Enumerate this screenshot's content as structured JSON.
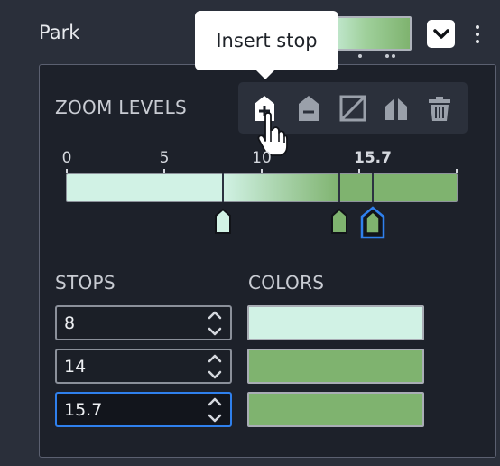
{
  "layer": {
    "title": "Park"
  },
  "tooltip": {
    "text": "Insert stop"
  },
  "zoom_levels": {
    "label": "ZOOM LEVELS",
    "tools": [
      {
        "name": "insert-stop",
        "icon": "insert-stop-icon"
      },
      {
        "name": "remove-stop",
        "icon": "remove-stop-icon"
      },
      {
        "name": "linear-interpolation",
        "icon": "linear-interpolation-icon"
      },
      {
        "name": "split-stops",
        "icon": "split-icon"
      },
      {
        "name": "delete-all",
        "icon": "trash-icon"
      }
    ],
    "ticks": [
      "0",
      "5",
      "10",
      "15.7"
    ],
    "tick_values": [
      0,
      5,
      10,
      15.7
    ],
    "range": [
      0,
      20
    ],
    "stop_values": [
      8,
      14,
      15.7
    ],
    "selected_stop_index": 2
  },
  "stops": {
    "label": "STOPS",
    "values": [
      "8",
      "14",
      "15.7"
    ]
  },
  "colors": {
    "label": "COLORS",
    "values": [
      "#d1f2e5",
      "#7fb36f",
      "#7fb36f"
    ]
  },
  "theme": {
    "focus_color": "#2f80ed",
    "light_green": "#d1f2e5",
    "dark_green": "#7fb36f"
  }
}
